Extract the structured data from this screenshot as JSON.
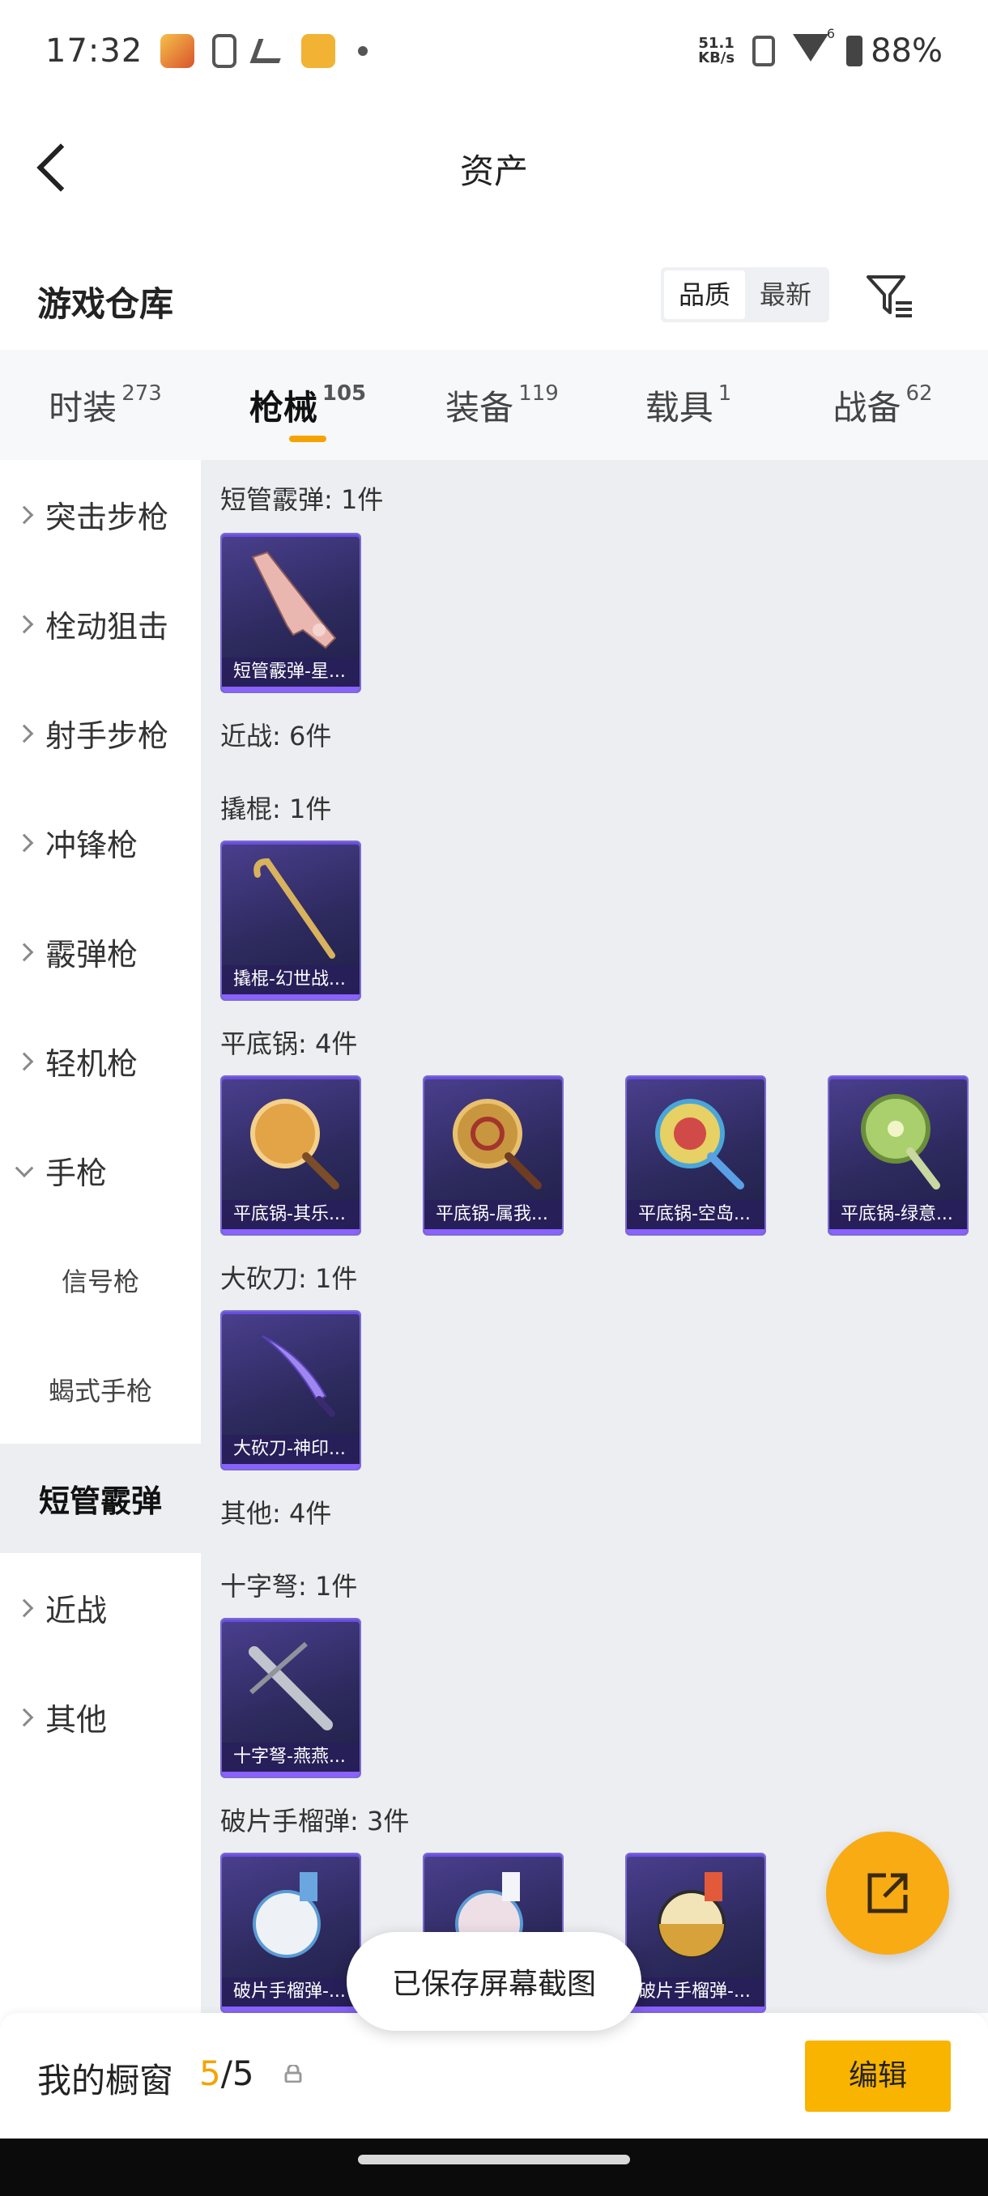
{
  "status": {
    "time": "17:32",
    "net_speed_value": "51.1",
    "net_speed_unit": "KB/s",
    "battery": "88%",
    "wifi_badge": "6"
  },
  "header": {
    "title": "资产"
  },
  "warehouse": {
    "title": "游戏仓库",
    "sort_quality": "品质",
    "sort_latest": "最新"
  },
  "tabs": [
    {
      "label": "时装",
      "count": "273"
    },
    {
      "label": "枪械",
      "count": "105"
    },
    {
      "label": "装备",
      "count": "119"
    },
    {
      "label": "载具",
      "count": "1"
    },
    {
      "label": "战备",
      "count": "62"
    }
  ],
  "side": [
    {
      "label": "突击步枪"
    },
    {
      "label": "栓动狙击"
    },
    {
      "label": "射手步枪"
    },
    {
      "label": "冲锋枪"
    },
    {
      "label": "霰弹枪"
    },
    {
      "label": "轻机枪"
    },
    {
      "label": "手枪"
    },
    {
      "label": "信号枪"
    },
    {
      "label": "蝎式手枪"
    },
    {
      "label": "短管霰弹"
    },
    {
      "label": "近战"
    },
    {
      "label": "其他"
    }
  ],
  "sections": {
    "s1": "短管霰弹: 1件",
    "s2": "近战: 6件",
    "s3": "撬棍: 1件",
    "s4": "平底锅: 4件",
    "s5": "大砍刀: 1件",
    "s6": "其他: 4件",
    "s7": "十字弩: 1件",
    "s8": "破片手榴弹: 3件"
  },
  "cards": {
    "c1": "短管霰弹-星...",
    "c2": "撬棍-幻世战...",
    "c3": "平底锅-其乐...",
    "c4": "平底锅-属我...",
    "c5": "平底锅-空岛...",
    "c6": "平底锅-绿意...",
    "c7": "大砍刀-神印...",
    "c8": "十字弩-燕燕...",
    "c9": "破片手榴弹-...",
    "c10": "",
    "c11": "破片手榴弹-..."
  },
  "toast": "已保存屏幕截图",
  "bottom": {
    "label": "我的橱窗",
    "current": "5",
    "separator": "/",
    "total": "5",
    "edit": "编辑"
  },
  "colors": {
    "accent": "#f9b400",
    "card_border": "#7c6ad0",
    "card_bg": "#2d2a5e",
    "content_bg": "#eceef2"
  }
}
